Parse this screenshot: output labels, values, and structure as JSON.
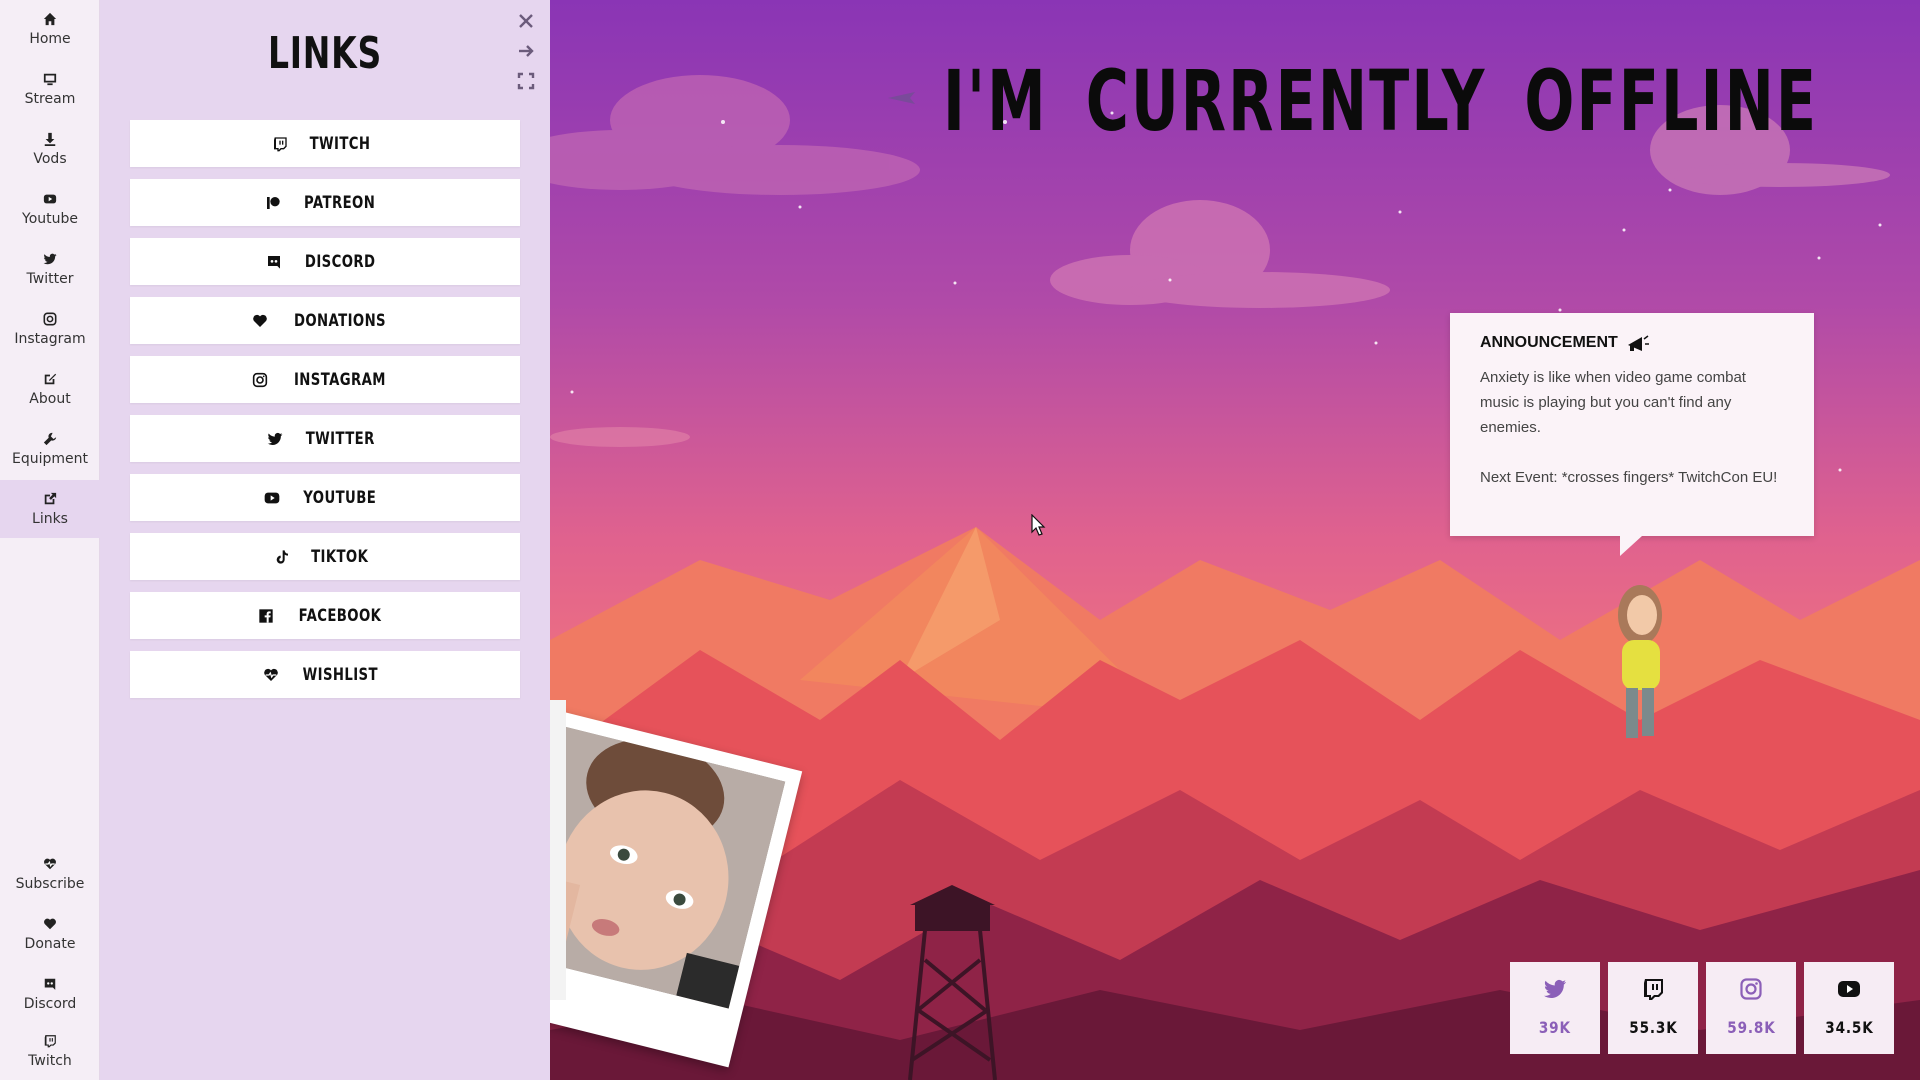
{
  "rail": {
    "top_items": [
      {
        "label": "Home",
        "icon": "home-icon"
      },
      {
        "label": "Stream",
        "icon": "monitor-icon"
      },
      {
        "label": "Vods",
        "icon": "download-icon"
      },
      {
        "label": "Youtube",
        "icon": "youtube-icon"
      },
      {
        "label": "Twitter",
        "icon": "twitter-icon"
      },
      {
        "label": "Instagram",
        "icon": "instagram-icon"
      },
      {
        "label": "About",
        "icon": "edit-icon"
      },
      {
        "label": "Equipment",
        "icon": "wrench-icon"
      },
      {
        "label": "Links",
        "icon": "external-link-icon"
      }
    ],
    "bottom_items": [
      {
        "label": "Subscribe",
        "icon": "heart-pulse-icon"
      },
      {
        "label": "Donate",
        "icon": "heart-icon"
      },
      {
        "label": "Discord",
        "icon": "discord-icon"
      },
      {
        "label": "Twitch",
        "icon": "twitch-icon"
      }
    ],
    "active": "Links"
  },
  "panel": {
    "title": "LINKS",
    "links": [
      {
        "label": "TWITCH",
        "icon": "twitch-icon"
      },
      {
        "label": "PATREON",
        "icon": "patreon-icon"
      },
      {
        "label": "DISCORD",
        "icon": "discord-icon"
      },
      {
        "label": "DONATIONS",
        "icon": "heart-icon"
      },
      {
        "label": "INSTAGRAM",
        "icon": "instagram-icon"
      },
      {
        "label": "TWITTER",
        "icon": "twitter-icon"
      },
      {
        "label": "YOUTUBE",
        "icon": "youtube-icon"
      },
      {
        "label": "TIKTOK",
        "icon": "tiktok-icon"
      },
      {
        "label": "FACEBOOK",
        "icon": "facebook-icon"
      },
      {
        "label": "WISHLIST",
        "icon": "heart-pulse-icon"
      }
    ]
  },
  "hero": {
    "title": "I'M CURRENTLY OFFLINE"
  },
  "announcement": {
    "heading": "ANNOUNCEMENT",
    "body": "Anxiety is like when video game combat music is playing but you can't find any enemies.",
    "event": "Next Event: *crosses fingers* TwitchCon EU!"
  },
  "stats": [
    {
      "platform": "twitter",
      "value": "39K",
      "color": "#8b5fb8"
    },
    {
      "platform": "twitch",
      "value": "55.3K",
      "color": "#111111"
    },
    {
      "platform": "instagram",
      "value": "59.8K",
      "color": "#8b5fb8"
    },
    {
      "platform": "youtube",
      "value": "34.5K",
      "color": "#111111"
    }
  ],
  "colors": {
    "sky_top": "#8a35b5",
    "sky_bottom": "#f0707c",
    "panel_bg": "#e6d6ef",
    "rail_bg": "#f5eef6"
  }
}
